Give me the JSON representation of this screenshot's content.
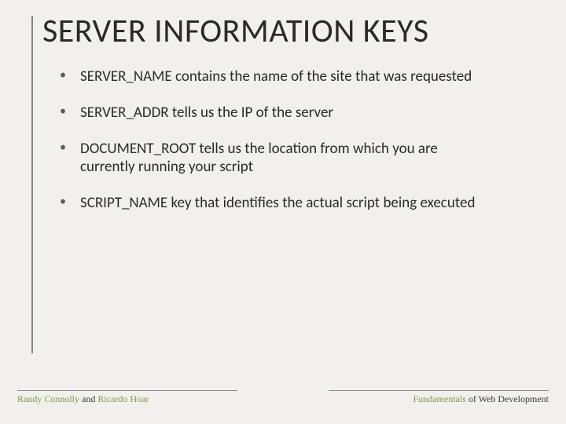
{
  "slide": {
    "title": "SERVER INFORMATION KEYS",
    "bullets": [
      "SERVER_NAME contains the name of the site that was requested",
      "SERVER_ADDR tells us the IP of the server",
      "DOCUMENT_ROOT tells us the location from which you are currently running your script",
      "SCRIPT_NAME key that identifies the actual script being executed"
    ]
  },
  "footer": {
    "left_author1": "Randy Connolly",
    "left_joiner": " and ",
    "left_author2": "Ricardo Hoar",
    "right_word1": "Fundamentals",
    "right_rest": " of Web Development"
  }
}
